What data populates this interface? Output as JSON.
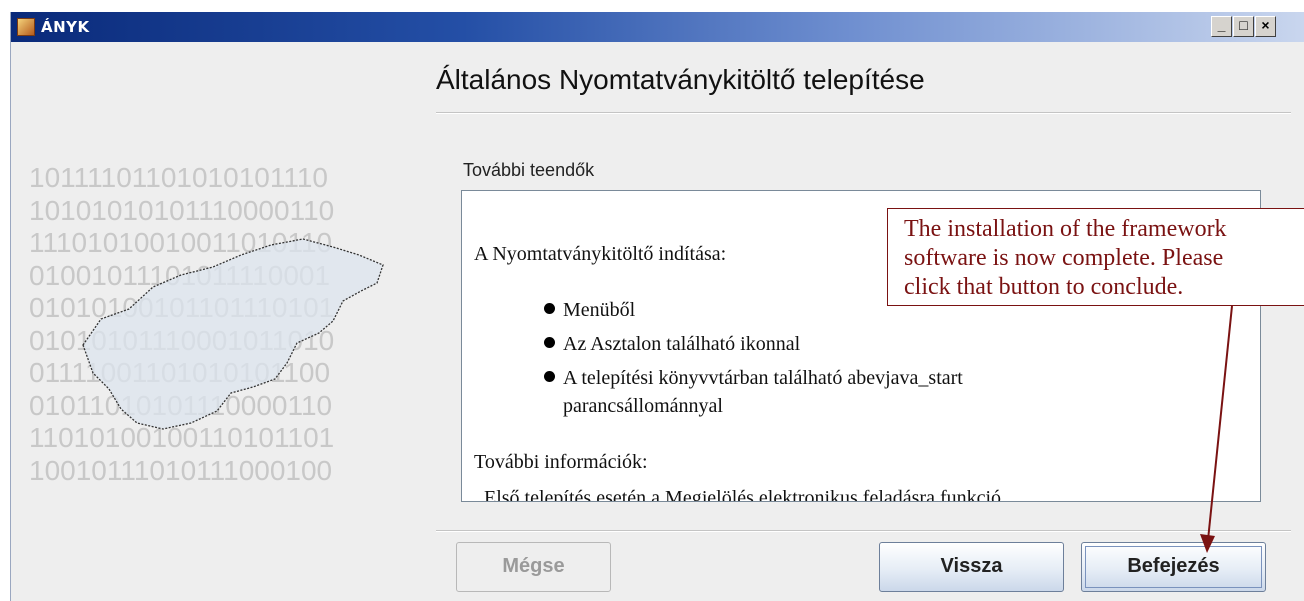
{
  "window": {
    "title": "ÁNYK",
    "minimize": "_",
    "maximize": "□",
    "close": "×"
  },
  "decoration": {
    "binary_lines": [
      "10111101101010101110",
      "10101010101110000110",
      "11101010010011010110",
      "01001011101011110001",
      "01010100101101110101",
      "01010101110001011010",
      "01111001101010101100",
      "01011010101110000110",
      "11010100100110101101",
      "10010111010111000100"
    ]
  },
  "header": {
    "title": "Általános Nyomtatványkitöltő telepítése"
  },
  "panel": {
    "label": "További teendők",
    "text": {
      "start_heading": "A Nyomtatványkitöltő indítása:",
      "bullets": [
        "Menüből",
        "Az Asztalon található ikonnal",
        "A telepítési könyvvtárban található abevjava_start"
      ],
      "bullet3_cont": "parancsállománnyal",
      "more_heading": "További információk:",
      "cut_line": "Első telepítés esetén a Megjelölés elektronikus feladásra funkció"
    }
  },
  "buttons": {
    "cancel": "Mégse",
    "back": "Vissza",
    "finish": "Befejezés"
  },
  "callout": {
    "lines": [
      "The installation of the framework",
      "software is now complete. Please",
      "click that button to conclude."
    ]
  },
  "colors": {
    "callout": "#7a1212",
    "titlebar": "#0a2a7a"
  }
}
